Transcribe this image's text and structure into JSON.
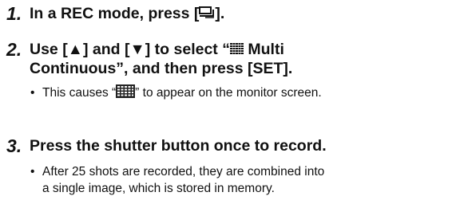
{
  "steps": [
    {
      "num": "1.",
      "line1_before": "In a REC mode, press [",
      "line1_icon": "continuous-shot-icon",
      "line1_after": "]."
    },
    {
      "num": "2.",
      "line1_before": "Use [▲] and [▼] to select “",
      "line1_icon": "multi-grid-icon",
      "line1_after": " Multi",
      "line2": "Continuous”, and then press [SET].",
      "bullet_before": "This causes “",
      "bullet_icon": "monitor-grid-icon",
      "bullet_after": "” to appear on the monitor screen."
    },
    {
      "num": "3.",
      "line1": "Press the shutter button once to record.",
      "bullet_line1": "After 25 shots are recorded, they are combined into",
      "bullet_line2": "a single image, which is stored in memory."
    }
  ],
  "bullet_symbol": "•"
}
